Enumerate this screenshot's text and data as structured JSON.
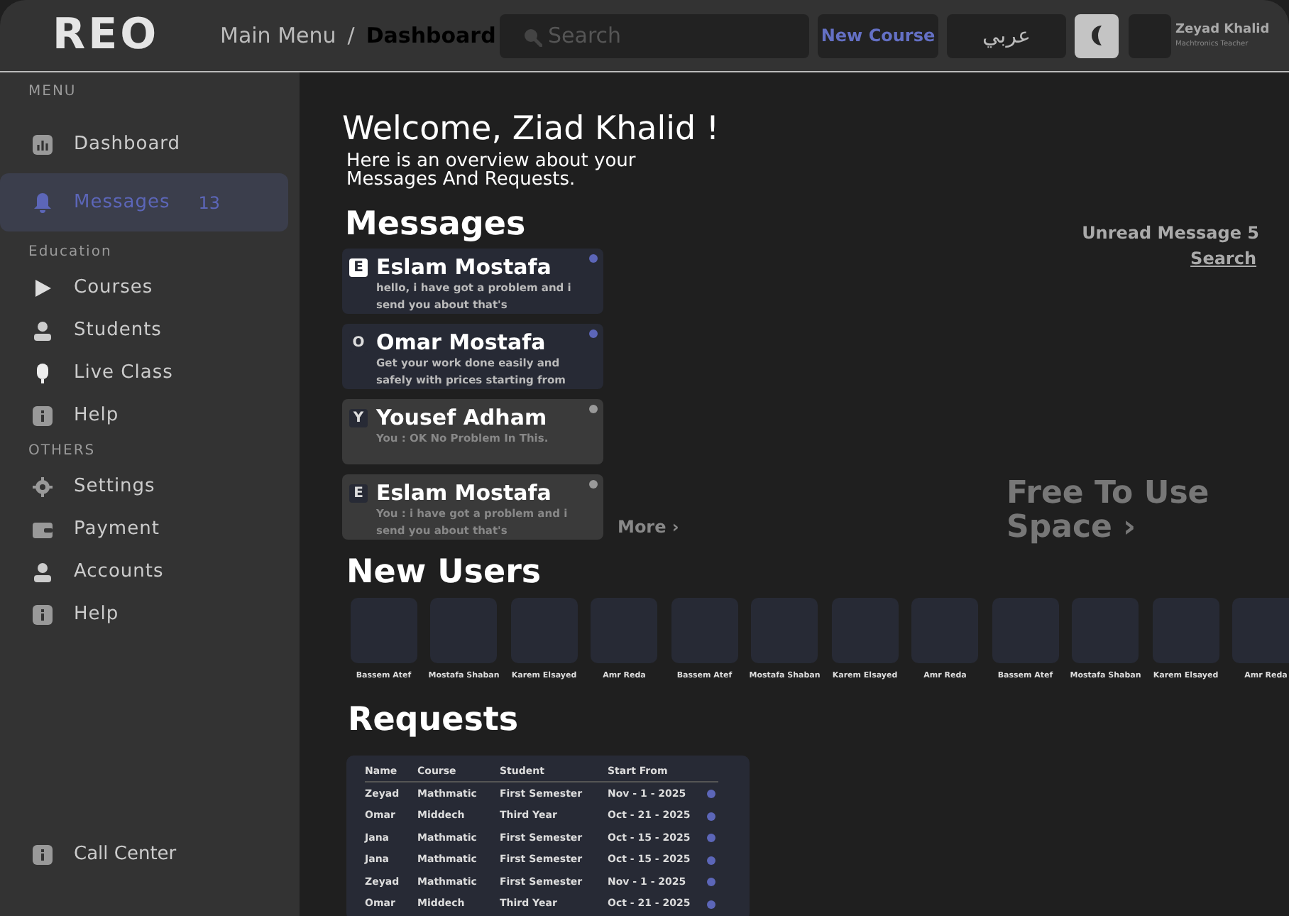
{
  "header": {
    "logo": "REO",
    "breadcrumb": [
      "Main Menu",
      "Dashboard"
    ],
    "breadcrumb_separator": "/",
    "search": {
      "placeholder": "Search"
    },
    "new_course": "New Course",
    "language": "عربي",
    "user": {
      "name": "Zeyad Khalid",
      "role": "Machtronics Teacher"
    }
  },
  "sidebar": {
    "sections": [
      {
        "title": "MENU",
        "items": [
          {
            "label": "Dashboard",
            "selected": false
          },
          {
            "label": "Messages",
            "count": "13",
            "selected": true
          }
        ]
      },
      {
        "title": "Education",
        "items": [
          {
            "label": "Courses",
            "selected": false
          },
          {
            "label": "Students",
            "selected": false
          },
          {
            "label": "Live Class",
            "selected": false
          },
          {
            "label": "Help",
            "selected": false
          }
        ]
      },
      {
        "title": "OTHERS",
        "items": [
          {
            "label": "Settings",
            "selected": false
          },
          {
            "label": "Payment",
            "selected": false
          },
          {
            "label": "Accounts",
            "selected": false
          },
          {
            "label": "Help",
            "selected": false
          }
        ]
      }
    ],
    "footer": "Call Center"
  },
  "welcome": {
    "title": "Welcome, Ziad Khalid !",
    "subtitle": "Here is an overview about your Messages And Requests."
  },
  "messages": {
    "title": "Messages",
    "unread_label": "Unread Message 5",
    "search_link": "Search",
    "more": "More ›",
    "items": [
      {
        "initial": "E",
        "name": "Eslam Mostafa",
        "text": "hello, i have got a problem and i send you about  that's",
        "unread": true,
        "selected": true
      },
      {
        "initial": "O",
        "name": "Omar Mostafa",
        "text": "Get your work done easily and safely with prices starting from",
        "unread": true,
        "selected": false
      },
      {
        "initial": "Y",
        "name": "Yousef Adham",
        "text": "You : OK No Problem In This.",
        "unread": false,
        "selected": false
      },
      {
        "initial": "E",
        "name": "Eslam Mostafa",
        "text": "You : i have got a problem and i send you about  that's",
        "unread": false,
        "selected": false
      }
    ]
  },
  "free_space": "Free To Use Space ›",
  "new_users": {
    "title": "New Users",
    "users": [
      "Bassem Atef",
      "Mostafa Shaban",
      "Karem Elsayed",
      "Amr Reda",
      "Bassem Atef",
      "Mostafa Shaban",
      "Karem Elsayed",
      "Amr Reda",
      "Bassem Atef",
      "Mostafa Shaban",
      "Karem Elsayed",
      "Amr Reda"
    ]
  },
  "requests": {
    "title": "Requests",
    "columns": [
      "Name",
      "Course",
      "Student",
      "Start From"
    ],
    "rows": [
      [
        "Zeyad",
        "Mathmatic",
        "First Semester",
        "Nov - 1 - 2025"
      ],
      [
        "Omar",
        "Middech",
        "Third Year",
        "Oct - 21 - 2025"
      ],
      [
        "Jana",
        "Mathmatic",
        "First Semester",
        "Oct - 15 - 2025"
      ],
      [
        "Jana",
        "Mathmatic",
        "First Semester",
        "Oct - 15 - 2025"
      ],
      [
        "Zeyad",
        "Mathmatic",
        "First Semester",
        "Nov - 1 - 2025"
      ],
      [
        "Omar",
        "Middech",
        "Third Year",
        "Oct - 21 - 2025"
      ]
    ]
  }
}
